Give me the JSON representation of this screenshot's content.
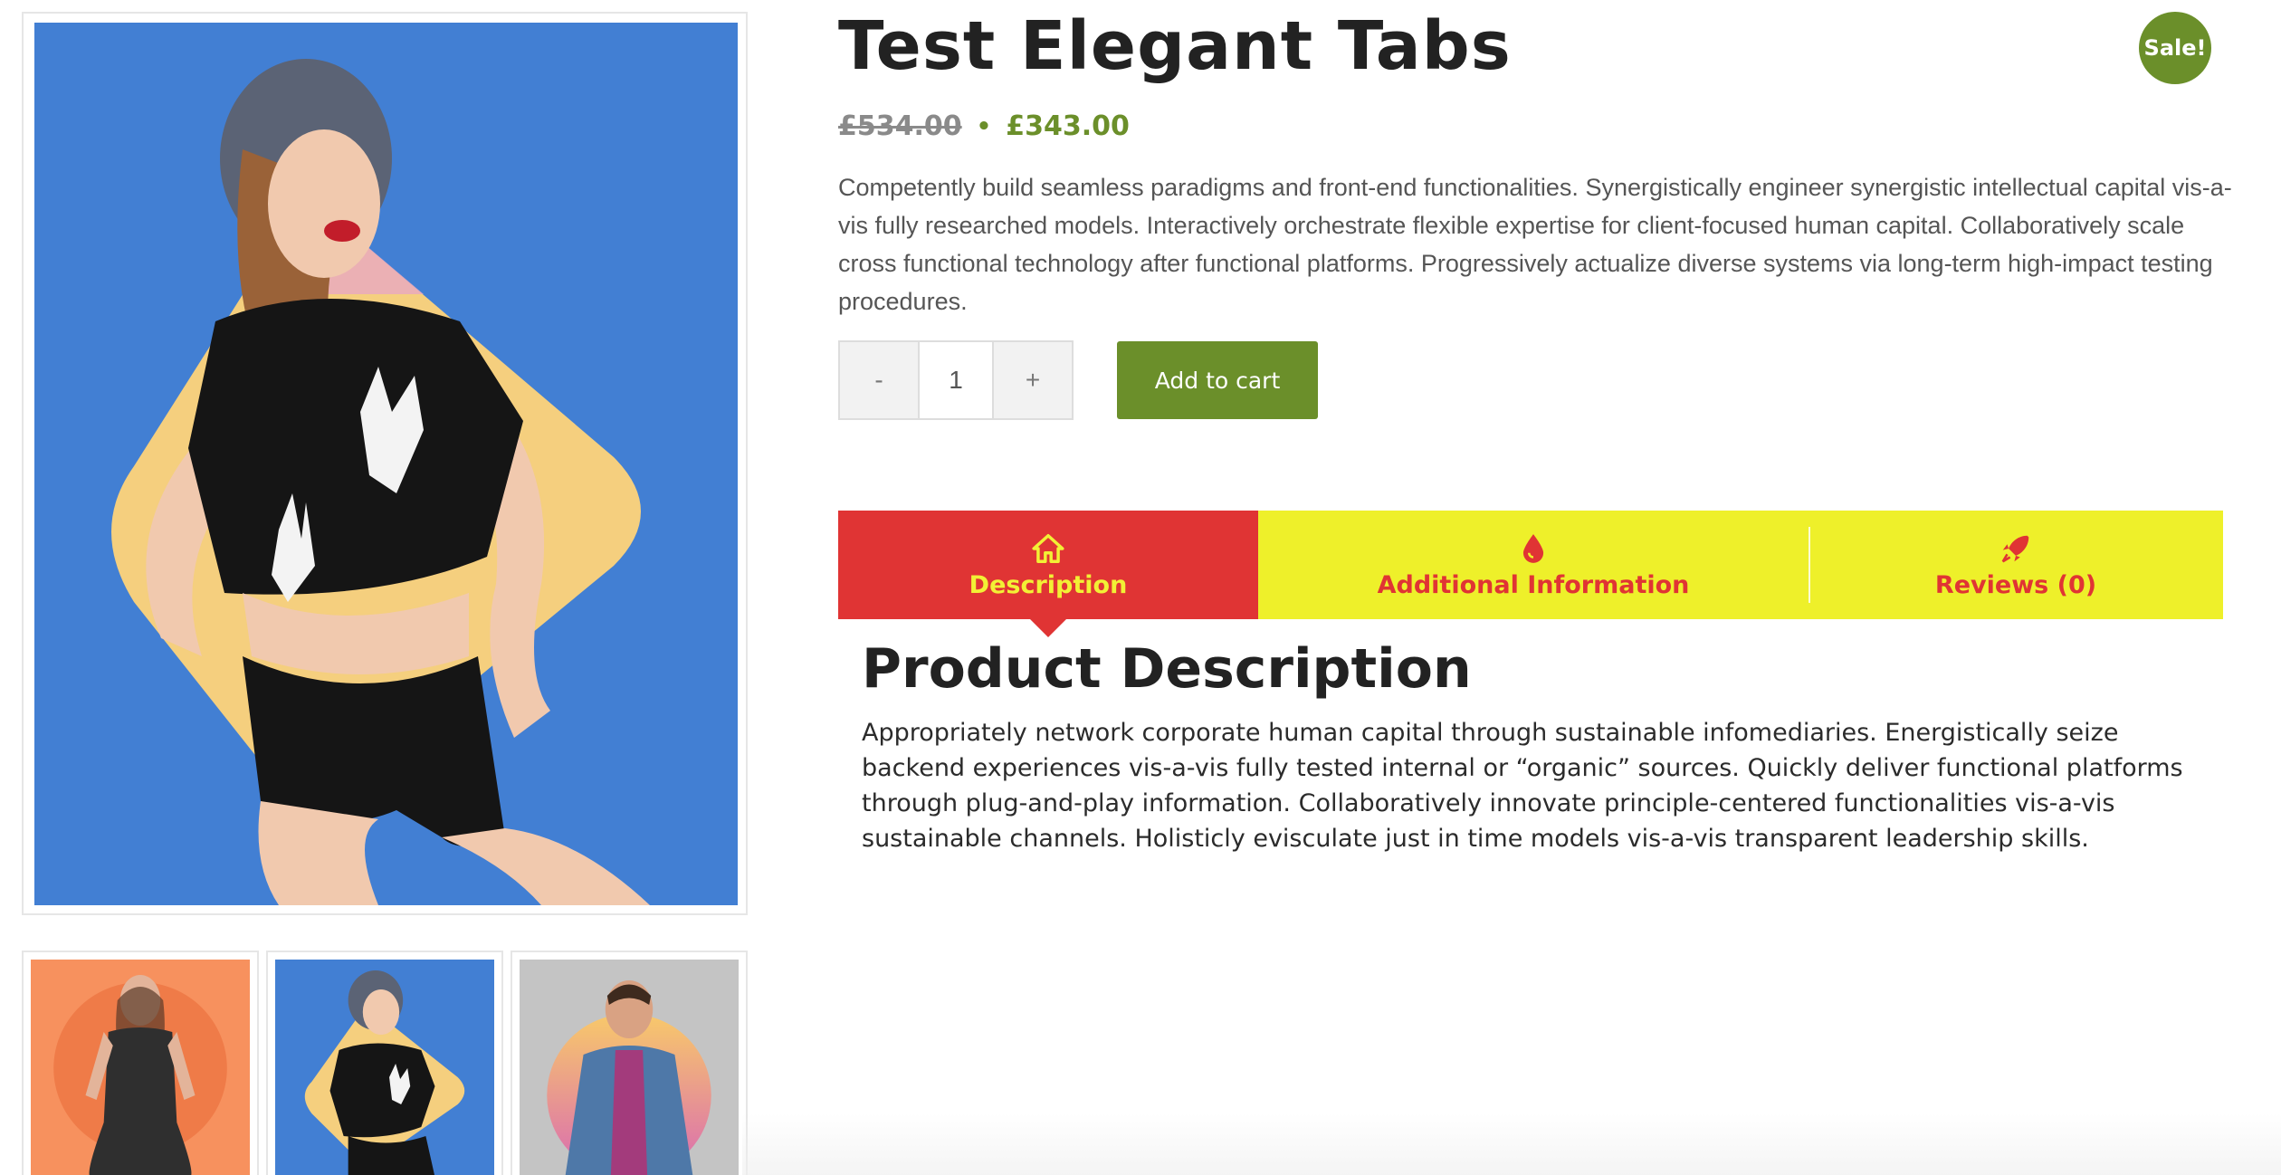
{
  "product": {
    "title": "Test Elegant Tabs",
    "sale_badge": "Sale!",
    "price_old": "£534.00",
    "price_separator": "•",
    "price_new": "£343.00",
    "short_description": "Competently build seamless paradigms and front-end functionalities. Synergistically engineer synergistic intellectual capital vis-a-vis fully researched models. Interactively orchestrate flexible expertise for client-focused human capital. Collaboratively scale cross functional technology after functional platforms. Progressively actualize diverse systems via long-term high-impact testing procedures."
  },
  "quantity": {
    "minus_label": "-",
    "value": "1",
    "plus_label": "+"
  },
  "cart": {
    "add_label": "Add to cart"
  },
  "tabs": [
    {
      "label": "Description",
      "icon": "home-icon",
      "active": true
    },
    {
      "label": "Additional Information",
      "icon": "drop-icon",
      "active": false
    },
    {
      "label": "Reviews (0)",
      "icon": "rocket-icon",
      "active": false
    }
  ],
  "panel": {
    "heading": "Product Description",
    "text": "Appropriately network corporate human capital through sustainable infomediaries. Energistically seize backend experiences vis-a-vis fully tested internal or “organic” sources. Quickly deliver functional platforms through plug-and-play information. Collaboratively innovate principle-centered functionalities vis-a-vis sustainable channels. Holisticly evisculate just in time models vis-a-vis transparent leadership skills."
  },
  "colors": {
    "accent_green": "#6b8f2a",
    "tab_active_bg": "#e03434",
    "tab_bar_bg": "#eef02a",
    "main_image_bg": "#427fd3"
  }
}
